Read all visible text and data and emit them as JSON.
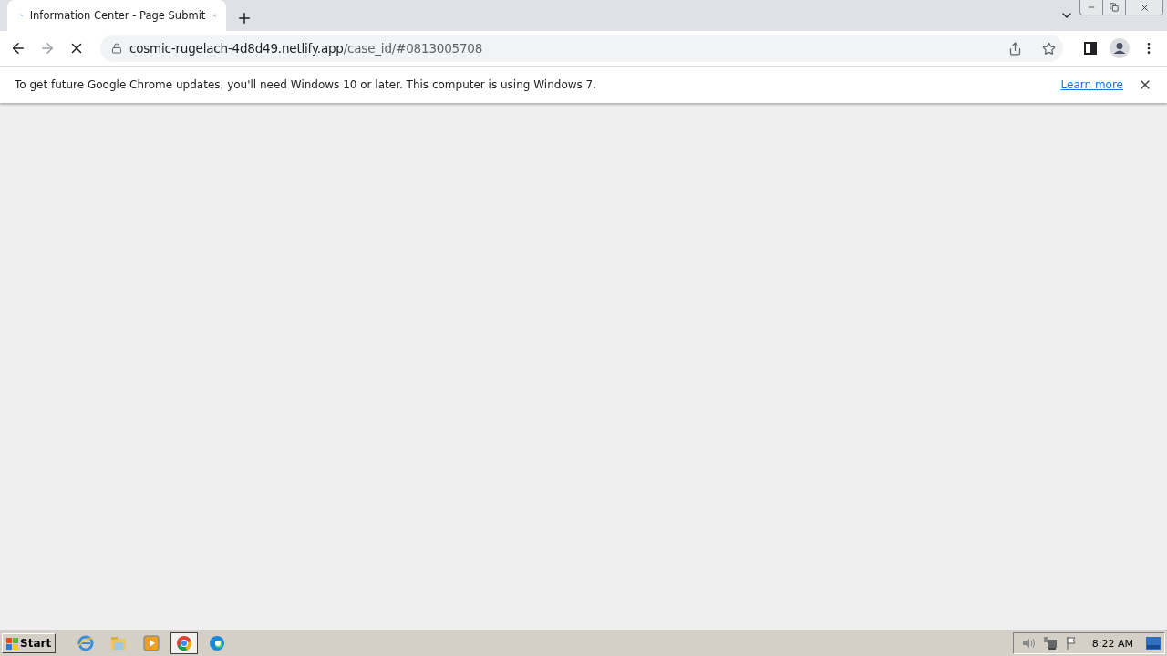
{
  "tab": {
    "title": "Information Center - Page Submit",
    "loading": true
  },
  "address": {
    "host": "cosmic-rugelach-4d8d49.netlify.app",
    "path": "/case_id/#0813005708"
  },
  "infobar": {
    "message": "To get future Google Chrome updates, you'll need Windows 10 or later. This computer is using Windows 7.",
    "link": "Learn more"
  },
  "taskbar": {
    "start": "Start",
    "apps": [
      {
        "kind": "ie",
        "selected": false
      },
      {
        "kind": "folder",
        "selected": false
      },
      {
        "kind": "media",
        "selected": false
      },
      {
        "kind": "chrome",
        "selected": true
      },
      {
        "kind": "edge",
        "selected": false
      }
    ],
    "clock": "8:22 AM"
  }
}
